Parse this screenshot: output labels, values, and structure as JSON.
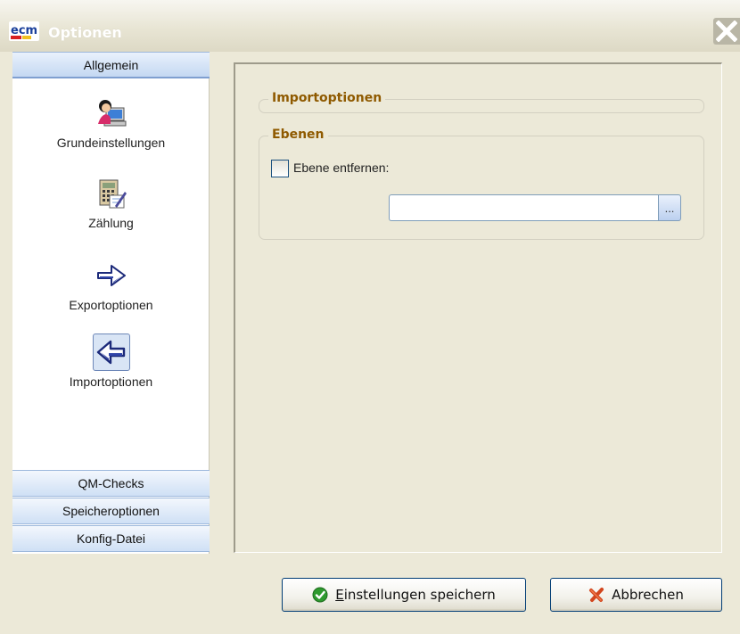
{
  "window": {
    "title": "Optionen",
    "logo_text": "ecm"
  },
  "nav": {
    "sections": [
      {
        "label": "Allgemein",
        "active": true
      },
      {
        "label": "QM-Checks",
        "active": false
      },
      {
        "label": "Speicheroptionen",
        "active": false
      },
      {
        "label": "Konfig-Datei",
        "active": false
      }
    ],
    "items": [
      {
        "label": "Grundeinstellungen",
        "icon": "user-computer-icon"
      },
      {
        "label": "Zählung",
        "icon": "calculator-icon"
      },
      {
        "label": "Exportoptionen",
        "icon": "arrow-right-icon"
      },
      {
        "label": "Importoptionen",
        "icon": "arrow-left-icon",
        "selected": true
      }
    ]
  },
  "panel": {
    "group_import_title": "Importoptionen",
    "group_layers_title": "Ebenen",
    "remove_layer_label": "Ebene entfernen:",
    "remove_layer_checked": false,
    "path_value": "",
    "browse_label": "..."
  },
  "buttons": {
    "save_mnemonic": "E",
    "save_rest": "instellungen speichern",
    "cancel_label": "Abbrechen"
  },
  "colors": {
    "dialog_bg": "#ece9d8",
    "group_title": "#8f5a00",
    "nav_header": "#cfe0f5",
    "save_icon": "#2e9a2e",
    "cancel_icon": "#d2461e"
  }
}
